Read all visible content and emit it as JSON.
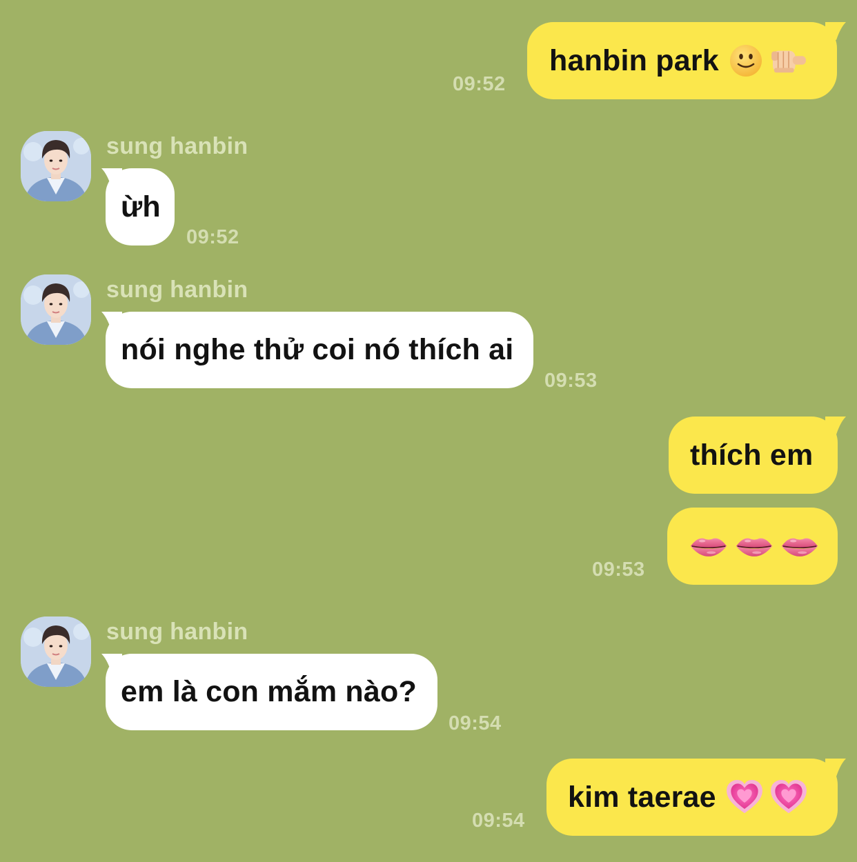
{
  "contact": {
    "name": "sung hanbin"
  },
  "messages": [
    {
      "id": "m1",
      "direction": "outgoing",
      "text": "hanbin park",
      "emoji": [
        "slightly-smiling-face",
        "backhand-index-pointing-at-viewer"
      ],
      "time": "09:52"
    },
    {
      "id": "m2",
      "direction": "incoming",
      "sender": "sung hanbin",
      "text": "ừh",
      "time": "09:52"
    },
    {
      "id": "m3",
      "direction": "incoming",
      "sender": "sung hanbin",
      "text": "nói nghe thử coi nó thích ai",
      "time": "09:53"
    },
    {
      "id": "m4",
      "direction": "outgoing",
      "text": "thích em"
    },
    {
      "id": "m5",
      "direction": "outgoing",
      "text": "",
      "emoji": [
        "lips",
        "lips",
        "lips"
      ],
      "time": "09:53"
    },
    {
      "id": "m6",
      "direction": "incoming",
      "sender": "sung hanbin",
      "text": "em là con mắm nào?",
      "time": "09:54"
    },
    {
      "id": "m7",
      "direction": "outgoing",
      "text": "kim taerae",
      "emoji": [
        "growing-heart",
        "growing-heart"
      ],
      "time": "09:54"
    }
  ],
  "colors": {
    "background": "#a0b265",
    "outgoing_bubble": "#fbe74c",
    "incoming_bubble": "#ffffff",
    "timestamp": "#d4ddb1",
    "sender_name": "#d9e2b7"
  }
}
